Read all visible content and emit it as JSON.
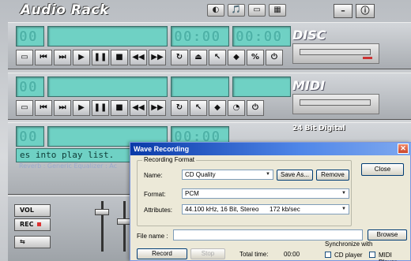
{
  "app": {
    "title": "Audio Rack",
    "window_buttons": [
      "–",
      "ⓘ"
    ],
    "top_icons": [
      "◐",
      "🎵",
      "▭",
      "▦"
    ]
  },
  "cd_panel": {
    "track": "00",
    "time_elapsed": "00:00",
    "time_total": "00:00",
    "logo": "DISC"
  },
  "midi_panel": {
    "track": "00",
    "logo": "MIDI"
  },
  "wave_panel": {
    "track": "00",
    "time_elapsed": "00:00",
    "badge": "24 Bit Digital",
    "playlist_text": "es into play list.",
    "playlist_sub": "Reverb : Generic    Equalizer : Ac"
  },
  "mixer": {
    "vol_label": "VOL",
    "rec_label": "REC"
  },
  "dialog": {
    "title": "Wave Recording",
    "group_label": "Recording Format",
    "name_label": "Name:",
    "name_value": "CD Quality",
    "save_as_button": "Save As...",
    "remove_button": "Remove",
    "format_label": "Format:",
    "format_value": "PCM",
    "attributes_label": "Attributes:",
    "attributes_value": "44.100 kHz, 16 Bit, Stereo",
    "attributes_rate": "172 kb/sec",
    "close_button": "Close",
    "file_name_label": "File name :",
    "file_name_value": "",
    "browse_button": "Browse",
    "record_button": "Record",
    "stop_button": "Stop",
    "total_time_label": "Total time:",
    "total_time_value": "00:00",
    "sync_label": "Synchronize with",
    "cd_player_label": "CD player",
    "midi_player_label": "MIDI Player"
  }
}
